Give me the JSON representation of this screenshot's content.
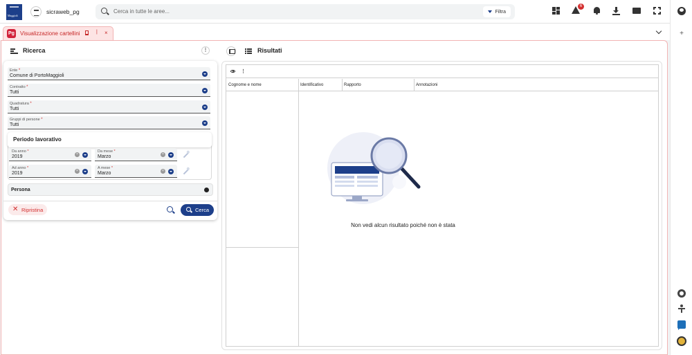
{
  "header": {
    "brand_logo": "Maggioli",
    "app_name": "sicraweb_pg",
    "search_placeholder": "Cerca in tutte le aree...",
    "filter_label": "Filtra",
    "alert_count": "6"
  },
  "tab": {
    "badge": "Pg",
    "label": "Visualizzazione cartellini",
    "separator": "|",
    "close": "×"
  },
  "left_panel": {
    "title": "Ricerca",
    "kebab": "⋮",
    "fields": [
      {
        "label": "Ente",
        "value": "Comune di PortoMaggioli",
        "required": "*"
      },
      {
        "label": "Contratto",
        "value": "Tutti",
        "required": "*"
      },
      {
        "label": "Quadratura",
        "value": "Tutti",
        "required": "*"
      },
      {
        "label": "Gruppi di persone",
        "value": "Tutti",
        "required": "*"
      }
    ],
    "period": {
      "title": "Periodo lavorativo",
      "da_anno": {
        "label": "Da anno",
        "value": "2019",
        "required": "*"
      },
      "da_mese": {
        "label": "Da mese",
        "value": "Marzo",
        "required": "*"
      },
      "ad_anno": {
        "label": "Ad anno",
        "value": "2019",
        "required": "*"
      },
      "a_mese": {
        "label": "A mese",
        "value": "Marzo",
        "required": "*"
      },
      "clear_glyph": "×"
    },
    "persona_label": "Persona",
    "reset_icon": "✕",
    "reset_label": "Ripristina",
    "search_label": "Cerca"
  },
  "right_panel": {
    "title": "Risultati",
    "kebab": "⋮",
    "columns_left": [
      "Cognome e nome"
    ],
    "columns_right": [
      "Identificativo",
      "Rapporto",
      "Annotazioni"
    ],
    "empty_message": "Non vedi alcun risultato poiché non è stata"
  },
  "rail": {
    "plus": "+"
  },
  "colors": {
    "primary": "#1d3f8a",
    "danger": "#d32f2f",
    "tab_bg": "#fde4e4"
  }
}
